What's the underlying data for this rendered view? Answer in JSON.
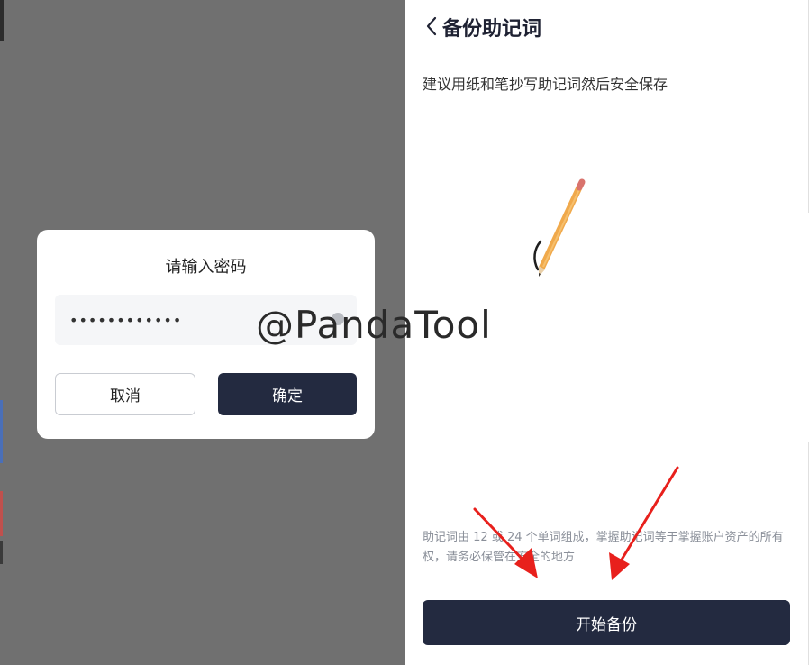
{
  "dialog": {
    "title": "请输入密码",
    "password_value": "••••••••••••",
    "cancel_label": "取消",
    "confirm_label": "确定"
  },
  "backup_page": {
    "title": "备份助记词",
    "subtitle": "建议用纸和笔抄写助记词然后安全保存",
    "notice": "助记词由 12 或 24 个单词组成，掌握助记词等于掌握账户资产的所有权，请务必保管在安全的地方",
    "start_button_label": "开始备份",
    "illustration": "pencil-illustration",
    "back_icon": "chevron-left-icon"
  },
  "watermark": "@PandaTool",
  "colors": {
    "primary_button": "#232a40",
    "overlay": "#707070",
    "annotation_arrow": "#e8201c"
  }
}
